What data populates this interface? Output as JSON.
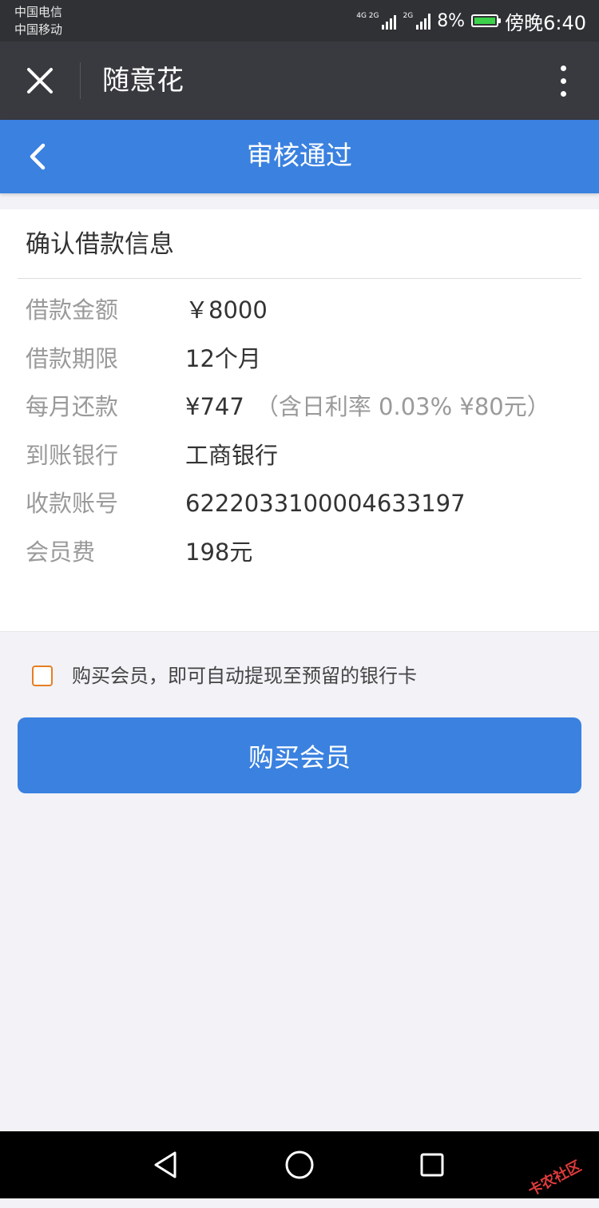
{
  "status_bar": {
    "carrier_1": "中国电信",
    "carrier_2": "中国移动",
    "signal_1_label": "4G 2G",
    "signal_2_label": "2G",
    "battery": "8%",
    "time": "傍晚6:40"
  },
  "wx_bar": {
    "title": "随意花"
  },
  "page_header": {
    "title": "审核通过"
  },
  "loan_card": {
    "title": "确认借款信息",
    "rows": [
      {
        "label": "借款金额",
        "value": "￥8000",
        "note": ""
      },
      {
        "label": "借款期限",
        "value": "12个月",
        "note": ""
      },
      {
        "label": "每月还款",
        "value": "¥747",
        "note": "（含日利率 0.03% ¥80元）"
      },
      {
        "label": "到账银行",
        "value": "工商银行",
        "note": ""
      },
      {
        "label": "收款账号",
        "value": "6222033100004633197",
        "note": ""
      },
      {
        "label": "会员费",
        "value": "198元",
        "note": ""
      }
    ]
  },
  "agreement": {
    "text": "购买会员，即可自动提现至预留的银行卡",
    "checked": false
  },
  "buy_button": {
    "label": "购买会员"
  },
  "watermark": {
    "text": "卡农社区"
  },
  "colors": {
    "primary": "#3a81e0",
    "checkbox_border": "#e67e22"
  }
}
